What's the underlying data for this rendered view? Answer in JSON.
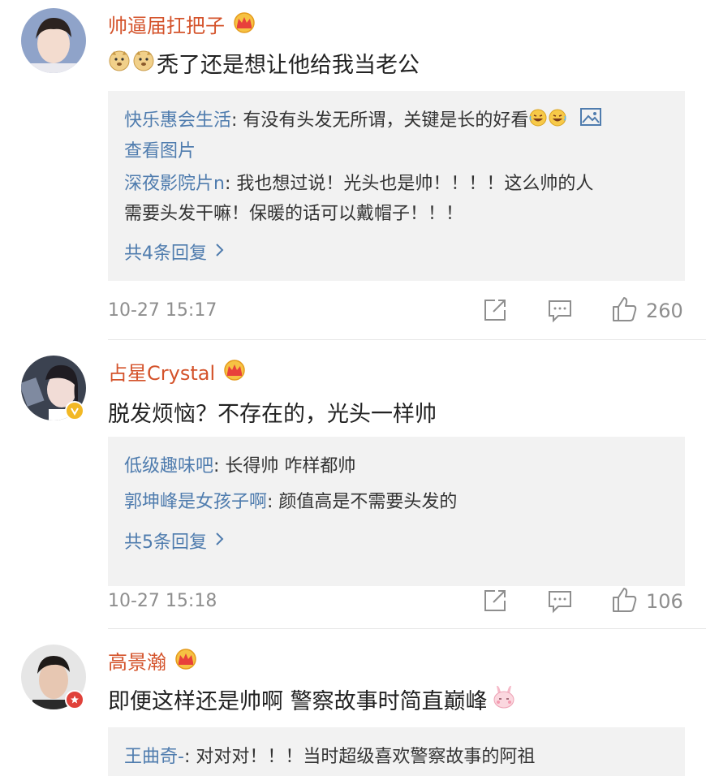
{
  "comments": [
    {
      "username": "帅逼届扛把子",
      "text": "秃了还是想让他给我当老公",
      "replies": [
        {
          "name": "快乐惠会生活",
          "text": ": 有没有头发无所谓，关键是长的好看",
          "link": "查看图片"
        },
        {
          "name": "深夜影院片n",
          "text": ": 我也想过说！光头也是帅！！！！这么帅的人",
          "text2": "需要头发干嘛！保暖的话可以戴帽子！！！"
        }
      ],
      "more": "共4条回复",
      "time": "10-27 15:17",
      "likes": "260"
    },
    {
      "username": "占星Crystal",
      "text": "脱发烦恼？不存在的，光头一样帅",
      "replies": [
        {
          "name": "低级趣味吧",
          "text": ": 长得帅 咋样都帅"
        },
        {
          "name": "郭坤峰是女孩子啊",
          "text": ": 颜值高是不需要头发的"
        }
      ],
      "more": "共5条回复",
      "time": "10-27 15:18",
      "likes": "106"
    },
    {
      "username": "高景瀚",
      "text": "即便这样还是帅啊 警察故事时简直巅峰",
      "replies": [
        {
          "name": "王曲奇-",
          "text": ": 对对对！！！当时超级喜欢警察故事的阿祖"
        }
      ]
    }
  ],
  "colors": {
    "username": "#d4532b",
    "reply_name": "#4f7cae",
    "reply_bg": "#f2f2f2",
    "meta": "#8e8e8e"
  },
  "icons": [
    "crown-icon",
    "doge-emoji",
    "laugh-emoji",
    "image-icon",
    "chevron-right-icon",
    "share-icon",
    "comment-icon",
    "like-icon",
    "verified-badge-icon",
    "bunny-emoji"
  ]
}
